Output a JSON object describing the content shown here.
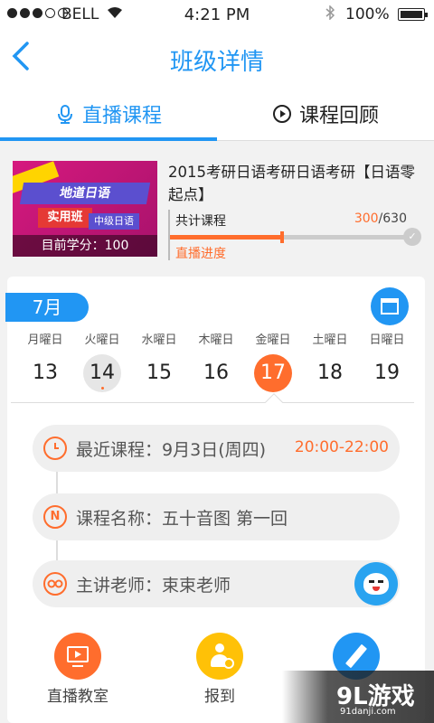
{
  "statusbar": {
    "carrier": "BELL",
    "time": "4:21 PM",
    "battery": "100%"
  },
  "navbar": {
    "back_icon": "chevron-left-icon",
    "title": "班级详情"
  },
  "tabs": [
    {
      "label": "直播课程",
      "icon": "microphone-icon",
      "active": true
    },
    {
      "label": "课程回顾",
      "icon": "play-circle-icon",
      "active": false
    }
  ],
  "course": {
    "cover": {
      "badge_main": "地道日语",
      "badge_class": "实用班",
      "badge_level": "中级日语",
      "credit": "目前学分：100"
    },
    "title": "2015考研日语考研日语考研【日语零起点】",
    "total_label": "共计课程",
    "done": "300",
    "total": "/630",
    "progress_fraction": 0.476,
    "progress_label": "直播进度"
  },
  "calendar": {
    "month": "7月",
    "days": [
      {
        "weekday": "月曜日",
        "num": "13",
        "state": ""
      },
      {
        "weekday": "火曜日",
        "num": "14",
        "state": "today"
      },
      {
        "weekday": "水曜日",
        "num": "15",
        "state": ""
      },
      {
        "weekday": "木曜日",
        "num": "16",
        "state": ""
      },
      {
        "weekday": "金曜日",
        "num": "17",
        "state": "sel"
      },
      {
        "weekday": "土曜日",
        "num": "18",
        "state": ""
      },
      {
        "weekday": "日曜日",
        "num": "19",
        "state": ""
      }
    ]
  },
  "info": {
    "recent_label": "最近课程：",
    "recent_date": "9月3日(周四)",
    "recent_time": "20:00-22:00",
    "name_label": "课程名称：",
    "name_value": "五十音图 第一回",
    "name_icon_text": "N",
    "teacher_label": "主讲老师：",
    "teacher_value": "束束老师"
  },
  "actions": [
    {
      "label": "直播教室",
      "icon": "tv-icon"
    },
    {
      "label": "报到",
      "icon": "check-in-icon"
    },
    {
      "label": "",
      "icon": "pencil-icon"
    }
  ],
  "watermark": {
    "main": "9L游戏",
    "sub": "91danji.com"
  },
  "colors": {
    "accent": "#2196f3",
    "highlight": "#ff6d2d",
    "checkin": "#ffc107"
  }
}
